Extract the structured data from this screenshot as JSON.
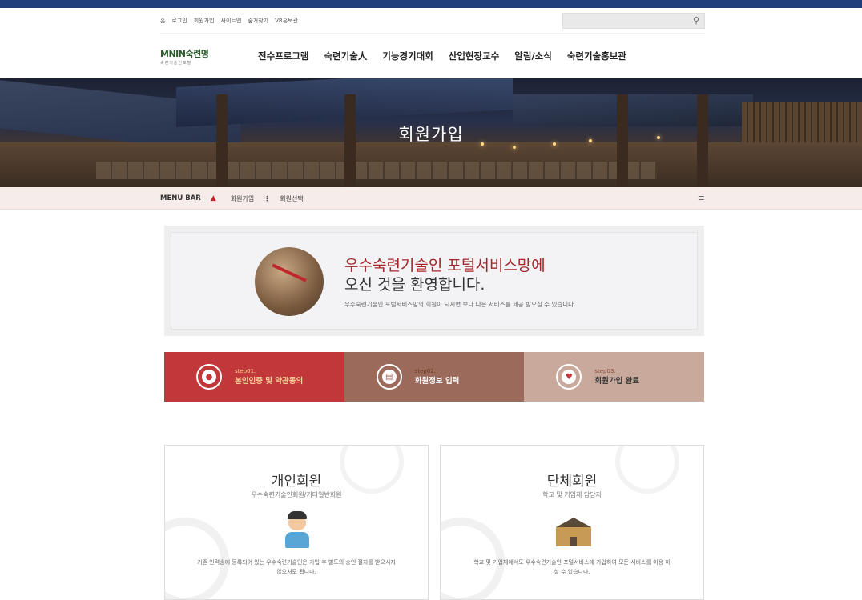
{
  "util_links": [
    "홈",
    "로그인",
    "회원가입",
    "사이트맵",
    "숲거찾기",
    "VR홍보관"
  ],
  "search": {
    "placeholder": ""
  },
  "logo": {
    "main": "MNIN숙련명",
    "sub": "숙련기술인포털"
  },
  "nav": [
    "전수프로그램",
    "숙련기술人",
    "기능경기대회",
    "산업현장교수",
    "알림/소식",
    "숙련기술홍보관"
  ],
  "hero": {
    "title": "회원가입"
  },
  "location": {
    "menubar": "MENU BAR",
    "crumb1": "회원가입",
    "crumb2": "회원선택"
  },
  "welcome": {
    "line1": "우수숙련기술인 포털서비스망에",
    "line2": "오신 것을 환영합니다.",
    "desc": "우수숙련기술인 포털서비스망의 회원이 되시면 보다 나은 서비스를 제공 받으실 수 있습니다."
  },
  "steps": [
    {
      "num": "step01.",
      "label": "본인인증 및 약관동의",
      "icon": "user-icon"
    },
    {
      "num": "step02.",
      "label": "회원정보 입력",
      "icon": "document-icon"
    },
    {
      "num": "step03.",
      "label": "회원가입 완료",
      "icon": "heart-icon"
    }
  ],
  "cards": [
    {
      "title": "개인회원",
      "subtitle": "우수숙련기술인회원/기타일반회원",
      "desc": "기존 인력송에 등록되어 있는 우수숙련기술인은 가입 후 별도의 승인 절차를 받으시지 않으셔도 됩니다.",
      "icon": "person-icon"
    },
    {
      "title": "단체회원",
      "subtitle": "학교 및 기업체 담당자",
      "desc": "학교 및 기업체에서도 우수숙련기술인 포털서비스에 가입하여 모든 서비스를 이용 하실 수 있습니다.",
      "icon": "building-icon"
    }
  ],
  "colors": {
    "accent": "#c2373a",
    "topbar": "#1f3d7a",
    "step2": "#9c6a5a",
    "step3": "#c8a99c"
  }
}
